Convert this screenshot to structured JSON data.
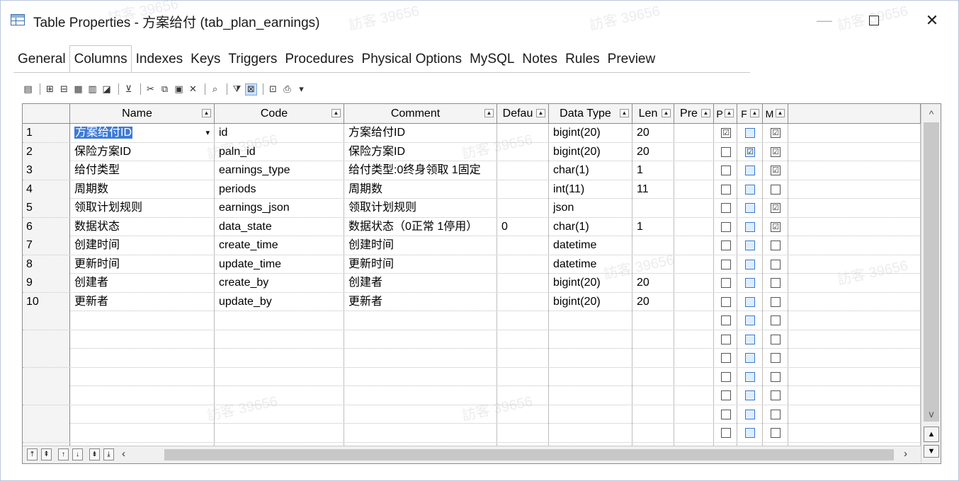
{
  "window": {
    "title": "Table Properties - 方案给付 (tab_plan_earnings)",
    "minimize": "—",
    "close": "✕"
  },
  "tabs": [
    "General",
    "Columns",
    "Indexes",
    "Keys",
    "Triggers",
    "Procedures",
    "Physical Options",
    "MySQL",
    "Notes",
    "Rules",
    "Preview"
  ],
  "active_tab": "Columns",
  "toolbar": {
    "icons": [
      "properties-icon",
      "insert-row-icon",
      "add-row-icon",
      "add-column-icon",
      "columns-icon",
      "clear-icon",
      "filter-icon",
      "cut-icon",
      "copy-icon",
      "paste-icon",
      "delete-icon",
      "find-icon",
      "customize-filter-icon",
      "auto-column-icon",
      "excel-icon",
      "print-icon",
      "dropdown-icon"
    ]
  },
  "grid": {
    "headers": [
      "Name",
      "Code",
      "Comment",
      "Defau",
      "Data Type",
      "Len",
      "Pre",
      "P",
      "F",
      "M"
    ],
    "rows": [
      {
        "num": "1",
        "name": "方案给付ID",
        "code": "id",
        "comment": "方案给付ID",
        "default": "",
        "type": "bigint(20)",
        "len": "20",
        "pre": "",
        "p": "☑",
        "f": "",
        "m": "☑"
      },
      {
        "num": "2",
        "name": "保险方案ID",
        "code": "paln_id",
        "comment": "保险方案ID",
        "default": "",
        "type": "bigint(20)",
        "len": "20",
        "pre": "",
        "p": "",
        "f": "☑",
        "m": "☑"
      },
      {
        "num": "3",
        "name": "给付类型",
        "code": "earnings_type",
        "comment": "给付类型:0终身领取 1固定",
        "default": "",
        "type": "char(1)",
        "len": "1",
        "pre": "",
        "p": "",
        "f": "",
        "m": "☑"
      },
      {
        "num": "4",
        "name": "周期数",
        "code": "periods",
        "comment": "周期数",
        "default": "",
        "type": "int(11)",
        "len": "11",
        "pre": "",
        "p": "",
        "f": "",
        "m": ""
      },
      {
        "num": "5",
        "name": "领取计划规则",
        "code": "earnings_json",
        "comment": "领取计划规则",
        "default": "",
        "type": "json",
        "len": "",
        "pre": "",
        "p": "",
        "f": "",
        "m": "☑"
      },
      {
        "num": "6",
        "name": "数据状态",
        "code": "data_state",
        "comment": "数据状态（0正常 1停用）",
        "default": "0",
        "type": "char(1)",
        "len": "1",
        "pre": "",
        "p": "",
        "f": "",
        "m": "☑"
      },
      {
        "num": "7",
        "name": "创建时间",
        "code": "create_time",
        "comment": "创建时间",
        "default": "",
        "type": "datetime",
        "len": "",
        "pre": "",
        "p": "",
        "f": "",
        "m": ""
      },
      {
        "num": "8",
        "name": "更新时间",
        "code": "update_time",
        "comment": "更新时间",
        "default": "",
        "type": "datetime",
        "len": "",
        "pre": "",
        "p": "",
        "f": "",
        "m": ""
      },
      {
        "num": "9",
        "name": "创建者",
        "code": "create_by",
        "comment": "创建者",
        "default": "",
        "type": "bigint(20)",
        "len": "20",
        "pre": "",
        "p": "",
        "f": "",
        "m": ""
      },
      {
        "num": "10",
        "name": "更新者",
        "code": "update_by",
        "comment": "更新者",
        "default": "",
        "type": "bigint(20)",
        "len": "20",
        "pre": "",
        "p": "",
        "f": "",
        "m": ""
      }
    ],
    "empty_rows": 8
  },
  "watermark": "訪客 39656",
  "colors": {
    "selection": "#3d7ad6",
    "header_bg": "#f4f4f4",
    "blue_checkbox": "#3a78d0"
  }
}
